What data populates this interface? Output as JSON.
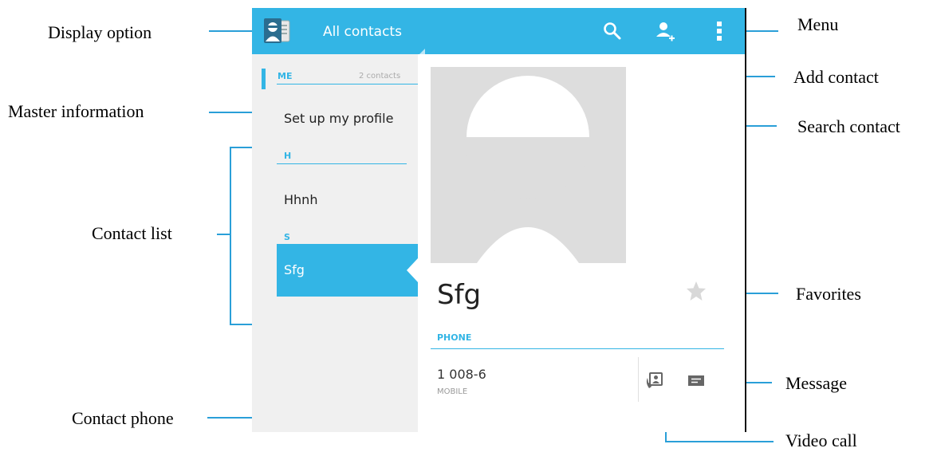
{
  "annotations": {
    "display_option": "Display option",
    "master_information": "Master information",
    "contact_list": "Contact list",
    "contact_phone": "Contact phone",
    "menu": "Menu",
    "add_contact": "Add contact",
    "search_contact": "Search contact",
    "favorites": "Favorites",
    "message": "Message",
    "video_call": "Video call"
  },
  "actionbar": {
    "title": "All contacts",
    "icons": [
      "contacts-app-icon",
      "search-icon",
      "add-contact-icon",
      "overflow-menu-icon"
    ]
  },
  "contact_list": {
    "me_header": "ME",
    "me_count": "2 contacts",
    "profile_item": "Set up my profile",
    "sections": [
      {
        "letter": "H",
        "items": [
          "Hhnh"
        ]
      },
      {
        "letter": "S",
        "items": [
          "Sfg"
        ]
      }
    ],
    "selected": "Sfg"
  },
  "detail": {
    "name": "Sfg",
    "phone_header": "PHONE",
    "phone_number": "1 008-6",
    "phone_type": "MOBILE",
    "icons": [
      "avatar-placeholder",
      "favorite-star-icon",
      "video-call-icon",
      "message-icon"
    ]
  },
  "colors": {
    "accent": "#33b5e5",
    "callout_line": "#2a9fd8"
  }
}
